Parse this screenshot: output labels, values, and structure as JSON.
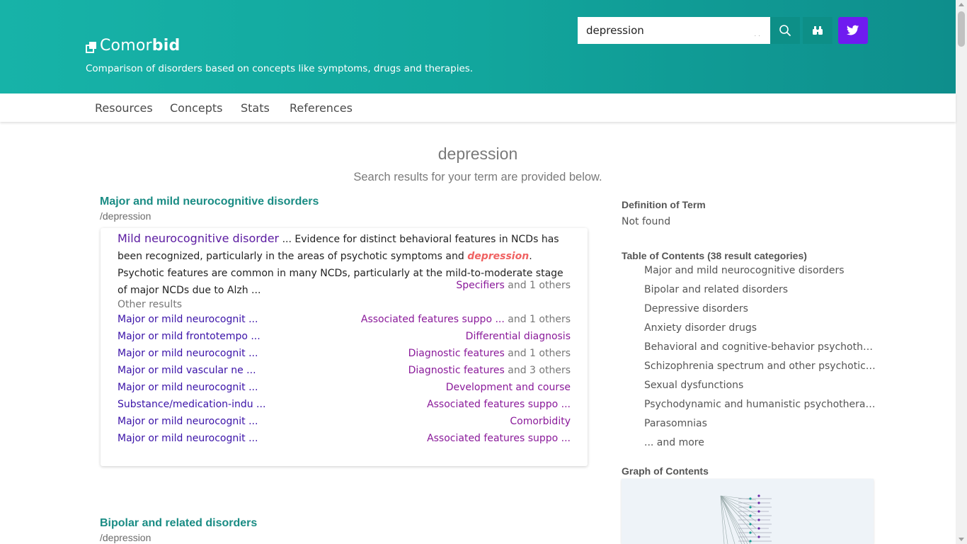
{
  "header": {
    "brand_light": "Comor",
    "brand_bold": "bid",
    "tagline": "Comparison of disorders based on concepts like symptoms, drugs and therapies.",
    "search_value": "depression",
    "search_dots": ". .",
    "colors": {
      "header": "#12a69d",
      "twitter": "#6f1bf0"
    }
  },
  "nav": {
    "items": [
      "Resources",
      "Concepts",
      "Stats",
      "References"
    ]
  },
  "page": {
    "title": "depression",
    "subtitle": "Search results for your term are provided below."
  },
  "results": [
    {
      "title": "Major and mild neurocognitive disorders",
      "path": "/depression",
      "main_link": "Mild neurocognitive disorder",
      "snippet_pre": " ... Evidence for distinct behavioral features in NCDs has been recognized, particularly in the areas of psychotic symptoms and ",
      "snippet_hl": "depression",
      "snippet_post": ". Psychotic features are common in many NCDs, particularly at the mild-to-moderate stage of major NCDs due to Alzh ...",
      "spec_link": "Specifiers",
      "spec_suffix": " and 1 others",
      "other_label": "Other results",
      "others": [
        {
          "left": "Major or mild neurocognit ...",
          "right_link": "Associated features suppo ...",
          "right_suffix": " and 1 others"
        },
        {
          "left": "Major or mild frontotempo ...",
          "right_link": "Differential diagnosis",
          "right_suffix": ""
        },
        {
          "left": "Major or mild neurocognit ...",
          "right_link": "Diagnostic features",
          "right_suffix": " and 1 others"
        },
        {
          "left": "Major or mild vascular ne ...",
          "right_link": "Diagnostic features",
          "right_suffix": " and 3 others"
        },
        {
          "left": "Major or mild neurocognit ...",
          "right_link": "Development and course",
          "right_suffix": ""
        },
        {
          "left": "Substance/medication-indu ...",
          "right_link": "Associated features suppo ...",
          "right_suffix": ""
        },
        {
          "left": "Major or mild neurocognit ...",
          "right_link": "Comorbidity",
          "right_suffix": ""
        },
        {
          "left": "Major or mild neurocognit ...",
          "right_link": "Associated features suppo ...",
          "right_suffix": ""
        }
      ]
    },
    {
      "title": "Bipolar and related disorders",
      "path": "/depression"
    }
  ],
  "sidebar": {
    "definition_heading": "Definition of Term",
    "definition_value": "Not found",
    "toc_heading": "Table of Contents (38 result categories)",
    "toc_items": [
      "Major and mild neurocognitive disorders",
      "Bipolar and related disorders",
      "Depressive disorders",
      "Anxiety disorder drugs",
      "Behavioral and cognitive-behavior psychotherapies",
      "Schizophrenia spectrum and other psychotic disorders",
      "Sexual dysfunctions",
      "Psychodynamic and humanistic psychotherapies",
      "Parasomnias",
      "... and more"
    ],
    "graph_heading": "Graph of Contents"
  }
}
